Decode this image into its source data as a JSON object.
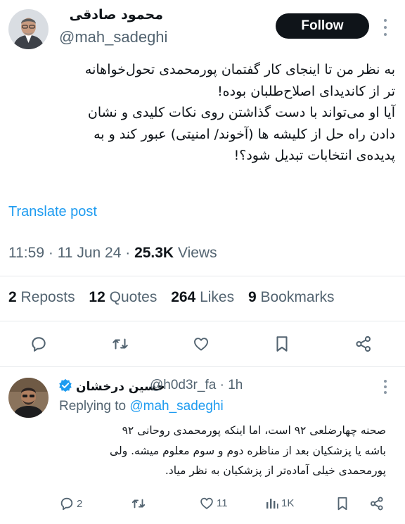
{
  "tweet": {
    "author": {
      "display_name": "محمود صادقی",
      "handle": "@mah_sadeghi"
    },
    "follow_label": "Follow",
    "text_lines": [
      "به نظر من تا اینجای کار گفتمان پورمحمدی تحول‌خواهانه",
      "تر از کاندیدای اصلاح‌طلبان بوده!",
      "آیا او می‌تواند با دست گذاشتن روی نکات کلیدی و نشان",
      "دادن راه حل از کلیشه ها (آخوند/ امنیتی) عبور کند و به",
      "پدیده‌ی انتخابات تبدیل شود؟!"
    ],
    "translate_label": "Translate post",
    "time": "11:59",
    "separator": "·",
    "date": "11 Jun 24",
    "views_count": "25.3K",
    "views_label": "Views",
    "stats": {
      "reposts_count": "2",
      "reposts_label": "Reposts",
      "quotes_count": "12",
      "quotes_label": "Quotes",
      "likes_count": "264",
      "likes_label": "Likes",
      "bookmarks_count": "9",
      "bookmarks_label": "Bookmarks"
    },
    "actions": [
      "reply-icon",
      "repost-icon",
      "like-icon",
      "bookmark-icon",
      "share-icon"
    ]
  },
  "reply": {
    "author": {
      "display_name": "حسین درخشان",
      "verified": true,
      "handle": "@h0d3r_fa",
      "time": "1h"
    },
    "replying_prefix": "Replying to",
    "replying_handle": "@mah_sadeghi",
    "text_lines": [
      "صحنه چهارضلعی ۹۲ است، اما اینکه پورمحمدی روحانی ۹۲",
      "باشه یا پزشکیان بعد از مناظره دوم و سوم معلوم میشه. ولی",
      "پورمحمدی خیلی آماده‌تر از پزشکیان به نظر میاد."
    ],
    "actions": {
      "reply_count": "2",
      "like_count": "11",
      "views_count": "1K"
    }
  },
  "colors": {
    "text": "#0f1419",
    "secondary": "#536471",
    "link": "#1d9bf0",
    "follow_bg": "#0f1419",
    "verified": "#1d9bf0"
  }
}
